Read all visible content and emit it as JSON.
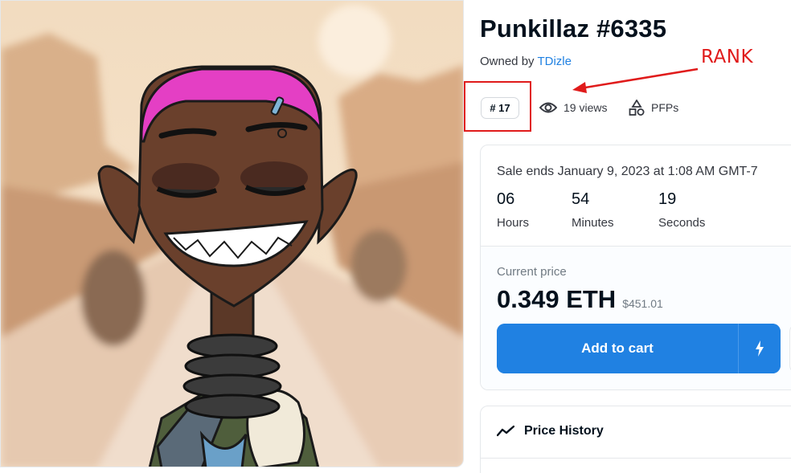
{
  "item": {
    "title": "Punkillaz #6335",
    "owned_by_label": "Owned by",
    "owner_name": "TDizle",
    "rank": "# 17",
    "views": "19 views",
    "category": "PFPs"
  },
  "annotation": {
    "text": "RANK",
    "color": "#e01b1b"
  },
  "sale": {
    "ends_text": "Sale ends January 9, 2023 at 1:08 AM GMT-7",
    "countdown": [
      {
        "value": "06",
        "unit": "Hours"
      },
      {
        "value": "54",
        "unit": "Minutes"
      },
      {
        "value": "19",
        "unit": "Seconds"
      }
    ],
    "current_price_label": "Current price",
    "price_eth": "0.349 ETH",
    "price_usd": "$451.01",
    "add_to_cart_label": "Add to cart"
  },
  "price_history": {
    "title": "Price History"
  },
  "icons": {
    "views": "eye-icon",
    "category": "shapes-icon",
    "buy_now": "lightning-icon",
    "history": "trending-line-icon"
  },
  "colors": {
    "accent": "#2081e2",
    "text_primary": "#04111d",
    "text_secondary": "#707a83",
    "border": "#e5e8eb"
  }
}
